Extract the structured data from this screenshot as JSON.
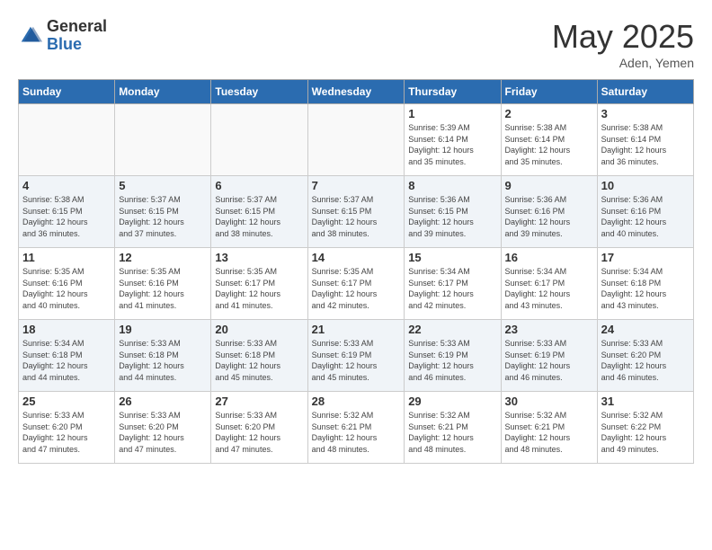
{
  "logo": {
    "general": "General",
    "blue": "Blue"
  },
  "title": "May 2025",
  "location": "Aden, Yemen",
  "days_of_week": [
    "Sunday",
    "Monday",
    "Tuesday",
    "Wednesday",
    "Thursday",
    "Friday",
    "Saturday"
  ],
  "weeks": [
    [
      {
        "day": "",
        "info": ""
      },
      {
        "day": "",
        "info": ""
      },
      {
        "day": "",
        "info": ""
      },
      {
        "day": "",
        "info": ""
      },
      {
        "day": "1",
        "info": "Sunrise: 5:39 AM\nSunset: 6:14 PM\nDaylight: 12 hours\nand 35 minutes."
      },
      {
        "day": "2",
        "info": "Sunrise: 5:38 AM\nSunset: 6:14 PM\nDaylight: 12 hours\nand 35 minutes."
      },
      {
        "day": "3",
        "info": "Sunrise: 5:38 AM\nSunset: 6:14 PM\nDaylight: 12 hours\nand 36 minutes."
      }
    ],
    [
      {
        "day": "4",
        "info": "Sunrise: 5:38 AM\nSunset: 6:15 PM\nDaylight: 12 hours\nand 36 minutes."
      },
      {
        "day": "5",
        "info": "Sunrise: 5:37 AM\nSunset: 6:15 PM\nDaylight: 12 hours\nand 37 minutes."
      },
      {
        "day": "6",
        "info": "Sunrise: 5:37 AM\nSunset: 6:15 PM\nDaylight: 12 hours\nand 38 minutes."
      },
      {
        "day": "7",
        "info": "Sunrise: 5:37 AM\nSunset: 6:15 PM\nDaylight: 12 hours\nand 38 minutes."
      },
      {
        "day": "8",
        "info": "Sunrise: 5:36 AM\nSunset: 6:15 PM\nDaylight: 12 hours\nand 39 minutes."
      },
      {
        "day": "9",
        "info": "Sunrise: 5:36 AM\nSunset: 6:16 PM\nDaylight: 12 hours\nand 39 minutes."
      },
      {
        "day": "10",
        "info": "Sunrise: 5:36 AM\nSunset: 6:16 PM\nDaylight: 12 hours\nand 40 minutes."
      }
    ],
    [
      {
        "day": "11",
        "info": "Sunrise: 5:35 AM\nSunset: 6:16 PM\nDaylight: 12 hours\nand 40 minutes."
      },
      {
        "day": "12",
        "info": "Sunrise: 5:35 AM\nSunset: 6:16 PM\nDaylight: 12 hours\nand 41 minutes."
      },
      {
        "day": "13",
        "info": "Sunrise: 5:35 AM\nSunset: 6:17 PM\nDaylight: 12 hours\nand 41 minutes."
      },
      {
        "day": "14",
        "info": "Sunrise: 5:35 AM\nSunset: 6:17 PM\nDaylight: 12 hours\nand 42 minutes."
      },
      {
        "day": "15",
        "info": "Sunrise: 5:34 AM\nSunset: 6:17 PM\nDaylight: 12 hours\nand 42 minutes."
      },
      {
        "day": "16",
        "info": "Sunrise: 5:34 AM\nSunset: 6:17 PM\nDaylight: 12 hours\nand 43 minutes."
      },
      {
        "day": "17",
        "info": "Sunrise: 5:34 AM\nSunset: 6:18 PM\nDaylight: 12 hours\nand 43 minutes."
      }
    ],
    [
      {
        "day": "18",
        "info": "Sunrise: 5:34 AM\nSunset: 6:18 PM\nDaylight: 12 hours\nand 44 minutes."
      },
      {
        "day": "19",
        "info": "Sunrise: 5:33 AM\nSunset: 6:18 PM\nDaylight: 12 hours\nand 44 minutes."
      },
      {
        "day": "20",
        "info": "Sunrise: 5:33 AM\nSunset: 6:18 PM\nDaylight: 12 hours\nand 45 minutes."
      },
      {
        "day": "21",
        "info": "Sunrise: 5:33 AM\nSunset: 6:19 PM\nDaylight: 12 hours\nand 45 minutes."
      },
      {
        "day": "22",
        "info": "Sunrise: 5:33 AM\nSunset: 6:19 PM\nDaylight: 12 hours\nand 46 minutes."
      },
      {
        "day": "23",
        "info": "Sunrise: 5:33 AM\nSunset: 6:19 PM\nDaylight: 12 hours\nand 46 minutes."
      },
      {
        "day": "24",
        "info": "Sunrise: 5:33 AM\nSunset: 6:20 PM\nDaylight: 12 hours\nand 46 minutes."
      }
    ],
    [
      {
        "day": "25",
        "info": "Sunrise: 5:33 AM\nSunset: 6:20 PM\nDaylight: 12 hours\nand 47 minutes."
      },
      {
        "day": "26",
        "info": "Sunrise: 5:33 AM\nSunset: 6:20 PM\nDaylight: 12 hours\nand 47 minutes."
      },
      {
        "day": "27",
        "info": "Sunrise: 5:33 AM\nSunset: 6:20 PM\nDaylight: 12 hours\nand 47 minutes."
      },
      {
        "day": "28",
        "info": "Sunrise: 5:32 AM\nSunset: 6:21 PM\nDaylight: 12 hours\nand 48 minutes."
      },
      {
        "day": "29",
        "info": "Sunrise: 5:32 AM\nSunset: 6:21 PM\nDaylight: 12 hours\nand 48 minutes."
      },
      {
        "day": "30",
        "info": "Sunrise: 5:32 AM\nSunset: 6:21 PM\nDaylight: 12 hours\nand 48 minutes."
      },
      {
        "day": "31",
        "info": "Sunrise: 5:32 AM\nSunset: 6:22 PM\nDaylight: 12 hours\nand 49 minutes."
      }
    ]
  ]
}
